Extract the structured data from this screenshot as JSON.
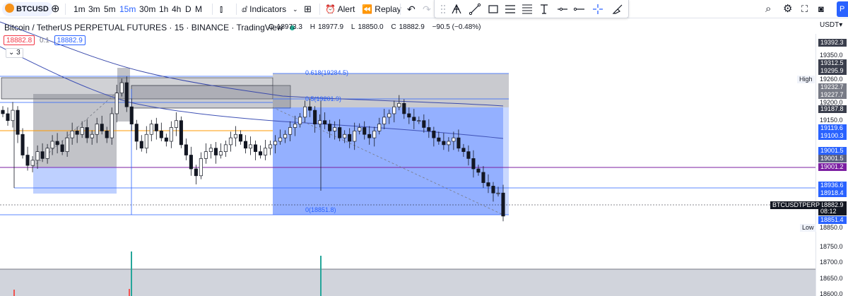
{
  "toolbar": {
    "symbol": "BTCUSD",
    "intervals": [
      "1m",
      "3m",
      "5m",
      "15m",
      "30m",
      "1h",
      "4h",
      "D",
      "M"
    ],
    "active_interval": "15m",
    "indicators_label": "Indicators",
    "alert_label": "Alert",
    "replay_label": "Replay"
  },
  "chart_header": {
    "title": "Bitcoin / TetherUS PERPETUAL FUTURES · 15 · BINANCE · TradingView",
    "ohlc": {
      "o_label": "O",
      "o": "18973.3",
      "h_label": "H",
      "h": "18977.9",
      "l_label": "L",
      "l": "18850.0",
      "c_label": "C",
      "c": "18882.9",
      "change": "−90.5 (−0.48%)"
    },
    "bid": "18882.8",
    "spread": "0.1",
    "ask": "18882.9",
    "collapse_count": "3",
    "currency": "USDT"
  },
  "fib_labels": {
    "f618": "0.618(19284.5)",
    "f05": "0.5(19201.9)",
    "f0": "0(18851.8)"
  },
  "price_scale": {
    "ticks": [
      "19392.3",
      "19350.0",
      "19312.5",
      "19295.9",
      "19260.0",
      "19232.7",
      "19227.7",
      "19200.0",
      "19187.8",
      "19150.0",
      "19119.6",
      "19100.3",
      "19001.5",
      "19001.5",
      "19001.2",
      "18936.6",
      "18918.4",
      "18882.9",
      "08:12",
      "18851.4",
      "18850.0",
      "18750.0",
      "18700.0",
      "18650.0",
      "18600.0"
    ],
    "high_label": "High",
    "low_label": "Low",
    "symbol_tag": "BTCUSDTPERP"
  },
  "colors": {
    "up": "#26a69a",
    "down": "#ef5350",
    "candle": "#131722",
    "blue_box": "#2962ff",
    "grey_box": "#787b86",
    "ma_blue": "#3949ab",
    "orange_line": "#ff9800",
    "purple_line": "#7b1fa2"
  },
  "chart_data": {
    "type": "candlestick",
    "ylim": [
      18600,
      19400
    ],
    "closes": [
      19180,
      19160,
      19190,
      19120,
      19060,
      19030,
      19045,
      19070,
      19050,
      19080,
      19100,
      19090,
      19070,
      19110,
      19130,
      19120,
      19140,
      19110,
      19120,
      19150,
      19130,
      19110,
      19180,
      19240,
      19270,
      19200,
      19150,
      19100,
      19080,
      19120,
      19150,
      19130,
      19110,
      19100,
      19140,
      19160,
      19090,
      19060,
      19020,
      19000,
      19050,
      19070,
      19080,
      19060,
      19070,
      19090,
      19110,
      19120,
      19100,
      19080,
      19090,
      19070,
      19060,
      19080,
      19090,
      19100,
      19110,
      19120,
      19140,
      19150,
      19170,
      19200,
      19190,
      19150,
      19160,
      19150,
      19130,
      19140,
      19110,
      19120,
      19100,
      19130,
      19140,
      19120,
      19110,
      19130,
      19150,
      19170,
      19180,
      19200,
      19210,
      19180,
      19170,
      19160,
      19160,
      19140,
      19130,
      19110,
      19100,
      19090,
      19100,
      19110,
      19080,
      19070,
      19050,
      19020,
      19010,
      18980,
      18970,
      18950,
      18950,
      18883
    ]
  }
}
